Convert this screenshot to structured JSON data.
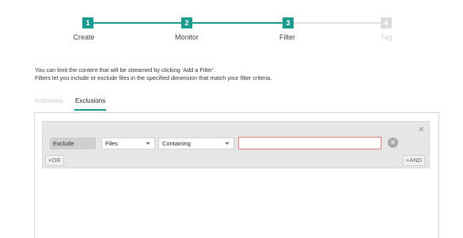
{
  "stepper": {
    "steps": [
      {
        "number": "1",
        "label": "Create",
        "state": "completed"
      },
      {
        "number": "2",
        "label": "Monitor",
        "state": "completed"
      },
      {
        "number": "3",
        "label": "Filter",
        "state": "current"
      },
      {
        "number": "4",
        "label": "Tag",
        "state": "upcoming"
      }
    ],
    "accent_color": "#1b9a8e"
  },
  "description": {
    "line1": "You can limit the content that will be streamed by clicking 'Add a Filter'.",
    "line2": "Filters let you include or exclude files in the specified dimension that match your filter criteria."
  },
  "tabs": [
    {
      "label": "Inclusions",
      "active": false
    },
    {
      "label": "Exclusions",
      "active": true
    }
  ],
  "filter": {
    "mode_label": "Exclude",
    "dimension": "Files",
    "operator": "Containing",
    "value": "",
    "close_icon": "close-icon",
    "remove_icon": "remove-icon",
    "or_label": "+OR",
    "and_label": "+AND",
    "input_border_color": "#e07b7b"
  }
}
